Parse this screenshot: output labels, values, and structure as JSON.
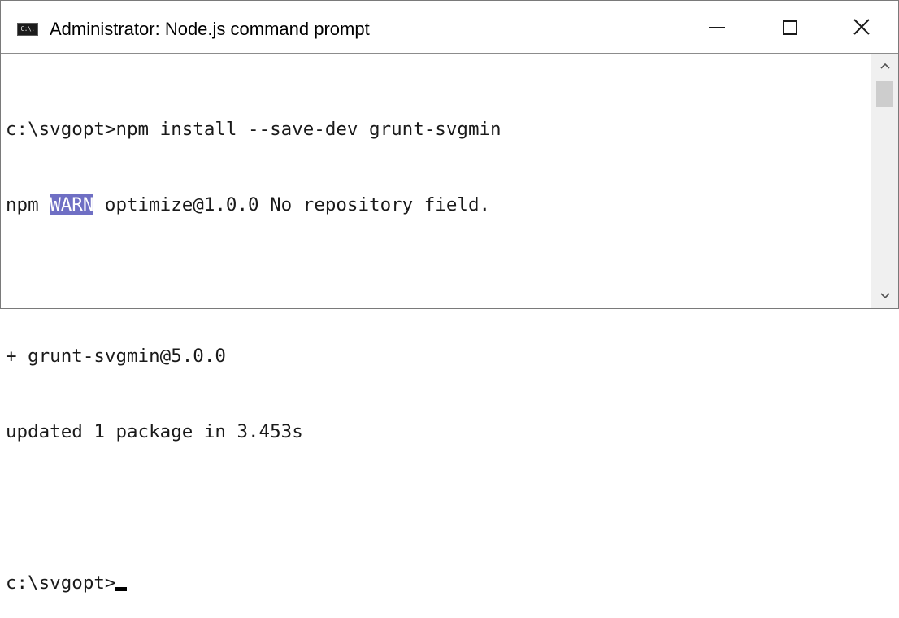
{
  "window": {
    "title": "Administrator: Node.js command prompt",
    "app_icon_text": "C:\\.",
    "icons": {
      "app": "command-prompt-icon",
      "minimize": "minimize-icon",
      "maximize": "maximize-icon",
      "close": "close-icon",
      "scroll_up": "chevron-up-icon",
      "scroll_down": "chevron-down-icon"
    }
  },
  "console": {
    "line1": "c:\\svgopt>npm install --save-dev grunt-svgmin",
    "line2_prefix": "npm ",
    "line2_highlight": "WARN",
    "line2_suffix": " optimize@1.0.0 No repository field.",
    "line3": "+ grunt-svgmin@5.0.0",
    "line4": "updated 1 package in 3.453s",
    "prompt": "c:\\svgopt>"
  },
  "colors": {
    "highlight_bg": "#6f6fc4",
    "highlight_fg": "#ffffff",
    "text": "#1a1a1a"
  }
}
